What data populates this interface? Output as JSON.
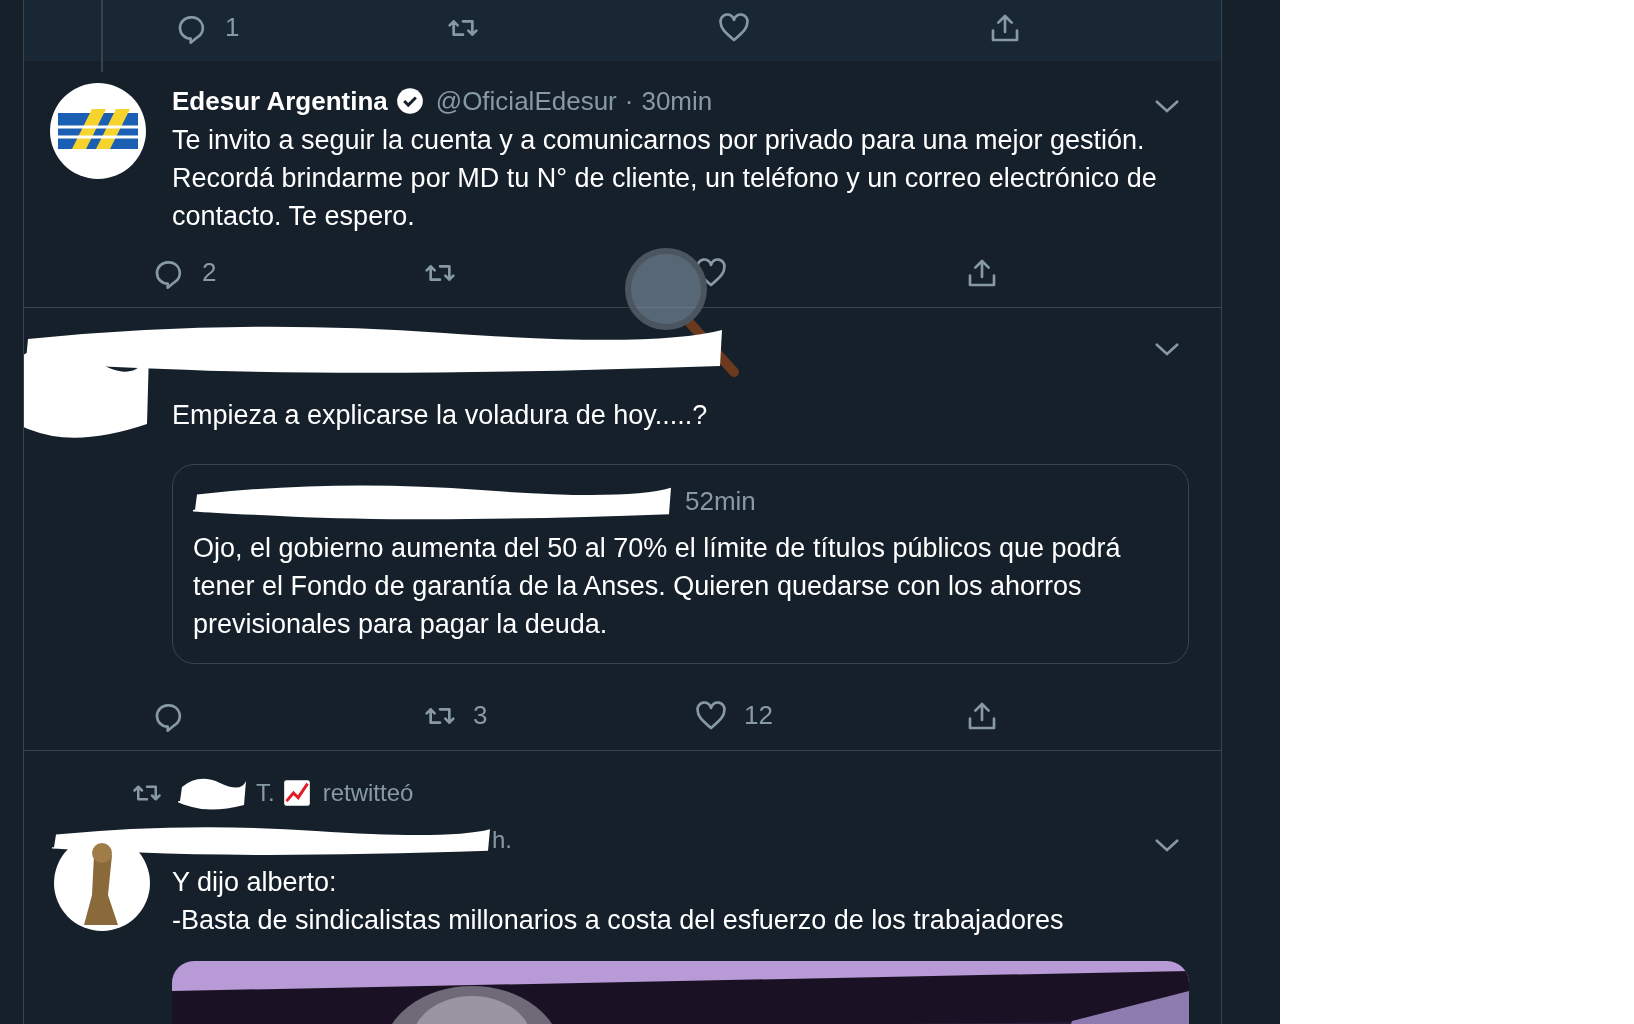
{
  "top_actions": [
    {
      "kind": "reply",
      "count": "1"
    },
    {
      "kind": "retweet"
    },
    {
      "kind": "like"
    },
    {
      "kind": "share"
    }
  ],
  "tweets": [
    {
      "kind": "tweet",
      "name": "Edesur Argentina",
      "verified": true,
      "handle": "@OficialEdesur",
      "separator": "·",
      "time": "30min",
      "text": "Te invito a seguir la cuenta y a comunicarnos por privado para una mejor gestión. Recordá brindarme por MD tu N° de cliente, un teléfono y un correo electrónico de contacto. Te espero.",
      "actions": [
        {
          "kind": "reply",
          "count": "2"
        },
        {
          "kind": "retweet"
        },
        {
          "kind": "like"
        },
        {
          "kind": "share"
        }
      ]
    },
    {
      "kind": "quote",
      "text": "Empieza a explicarse la voladura de hoy.....?",
      "quoted": {
        "time": "52min",
        "text": "Ojo, el gobierno aumenta del 50 al 70% el límite de títulos públicos que podrá tener el Fondo de garantía de la Anses. Quieren quedarse con los ahorros previsionales para pagar la deuda."
      },
      "actions": [
        {
          "kind": "reply"
        },
        {
          "kind": "retweet",
          "count": "3"
        },
        {
          "kind": "like",
          "count": "12"
        },
        {
          "kind": "share"
        }
      ]
    },
    {
      "kind": "retweeted",
      "retweeter": "T.",
      "retweet_label": "retwitteó",
      "time": "h.",
      "lines": [
        "Y dijo alberto:",
        "-Basta de sindicalistas millonarios a costa del esfuerzo de los trabajadores"
      ],
      "media": {
        "kind": "picture"
      }
    }
  ]
}
